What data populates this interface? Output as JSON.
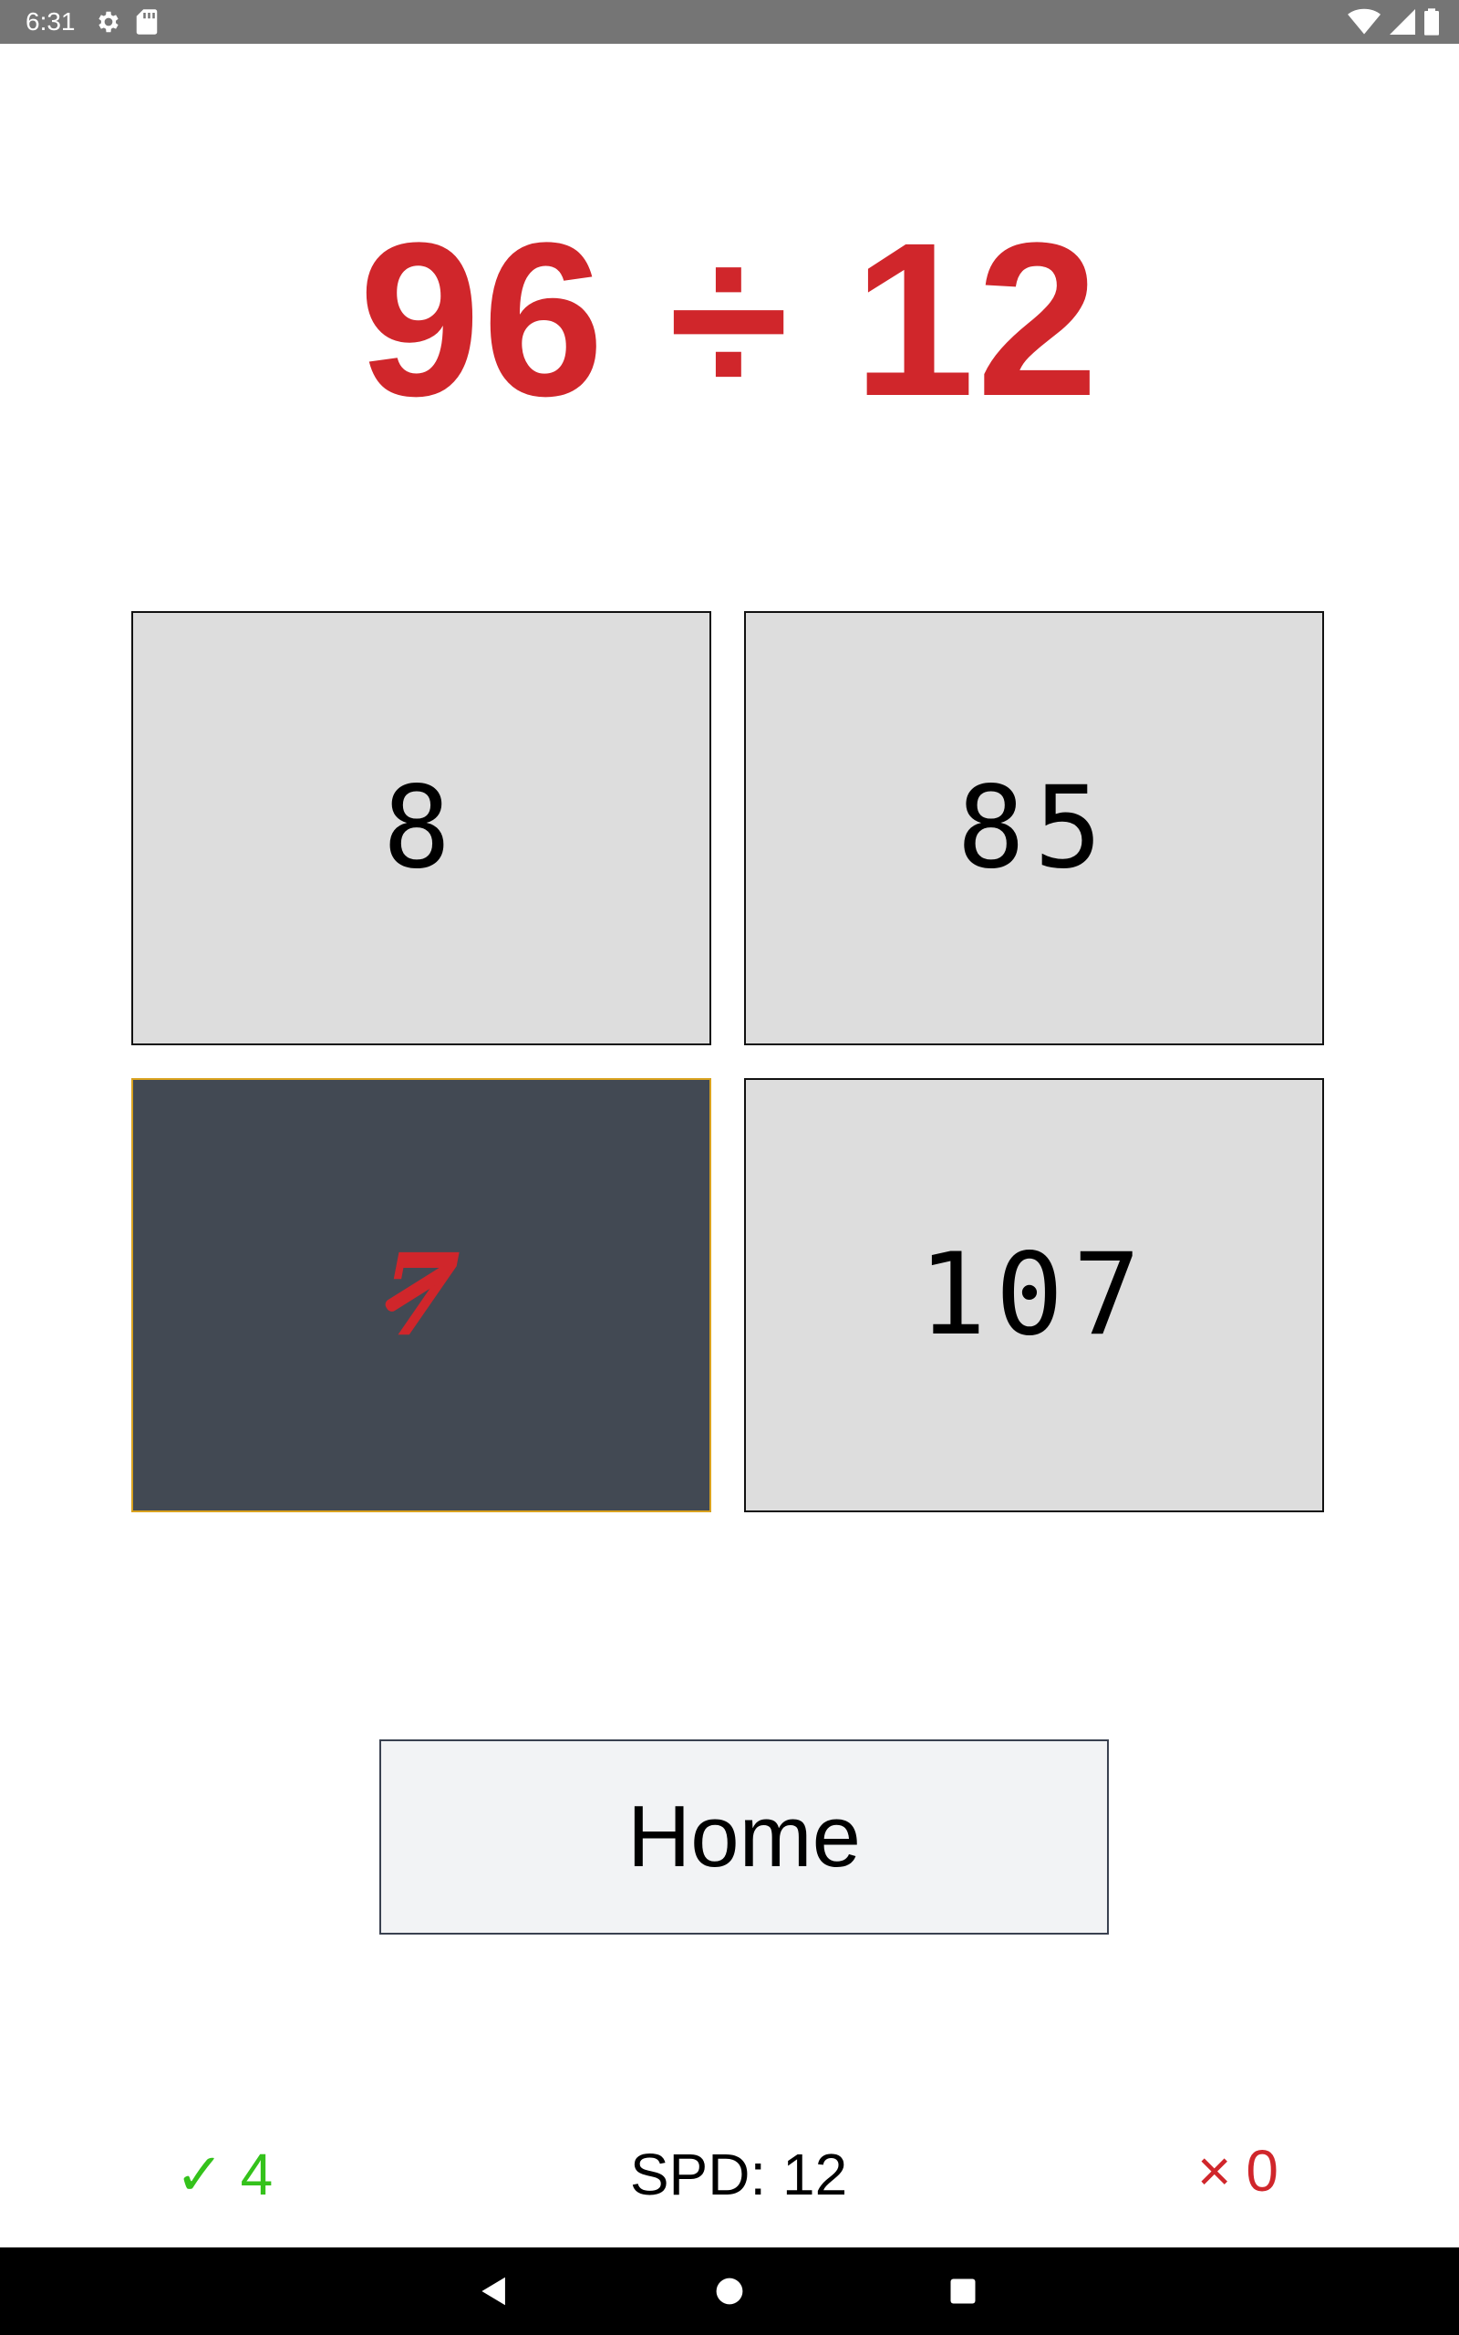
{
  "status_bar": {
    "time": "6:31",
    "left_icons": [
      "gear-icon",
      "sd-card-icon"
    ],
    "right_icons": [
      "wifi-icon",
      "signal-icon",
      "battery-icon"
    ]
  },
  "problem": {
    "text": "96 ÷ 12"
  },
  "answers": [
    {
      "value": "8",
      "selected": false
    },
    {
      "value": "85",
      "selected": false
    },
    {
      "value": "7",
      "selected": true,
      "marked_wrong": true
    },
    {
      "value": "107",
      "selected": false
    }
  ],
  "home_button": {
    "label": "Home"
  },
  "score": {
    "correct_symbol": "✓",
    "correct_count": "4",
    "speed_text": "SPD: 12",
    "wrong_symbol": "×",
    "wrong_count": "0"
  },
  "nav_bar": {
    "buttons": [
      "back-icon",
      "home-icon",
      "recents-icon"
    ]
  },
  "colors": {
    "problem": "#d0262b",
    "tile": "#dddddd",
    "selected_tile": "#424953",
    "selected_border": "#d9a21f",
    "correct": "#34c21b",
    "wrong": "#d0262b",
    "status_bar": "#757575",
    "nav_bar": "#000000"
  }
}
